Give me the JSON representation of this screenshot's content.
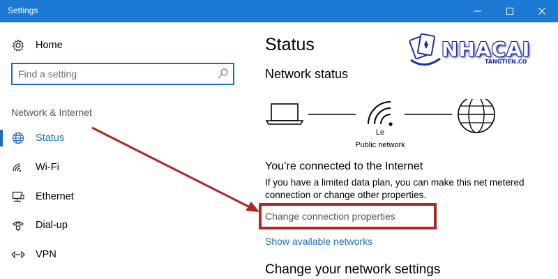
{
  "window": {
    "title": "Settings"
  },
  "sidebar": {
    "home_label": "Home",
    "search": {
      "placeholder": "Find a setting"
    },
    "section_label": "Network & Internet",
    "items": [
      {
        "label": "Status",
        "icon": "globe-icon",
        "selected": true
      },
      {
        "label": "Wi-Fi",
        "icon": "wifi-icon",
        "selected": false
      },
      {
        "label": "Ethernet",
        "icon": "ethernet-icon",
        "selected": false
      },
      {
        "label": "Dial-up",
        "icon": "dialup-icon",
        "selected": false
      },
      {
        "label": "VPN",
        "icon": "vpn-icon",
        "selected": false
      }
    ]
  },
  "main": {
    "title": "Status",
    "network_status_heading": "Network status",
    "network_name": "Le",
    "network_type": "Public network",
    "connected_heading": "You’re connected to the Internet",
    "connected_description": "If you have a limited data plan, you can make this net metered connection or change other properties.",
    "change_connection_link": "Change connection properties",
    "show_networks_link": "Show available networks",
    "change_settings_heading": "Change your network settings"
  },
  "logo": {
    "word": "NHACAI",
    "sub": "TANGTIEN.CO"
  },
  "colors": {
    "titlebar": "#1c7ad4",
    "accent": "#1a6dc7",
    "highlight": "#b32424"
  }
}
